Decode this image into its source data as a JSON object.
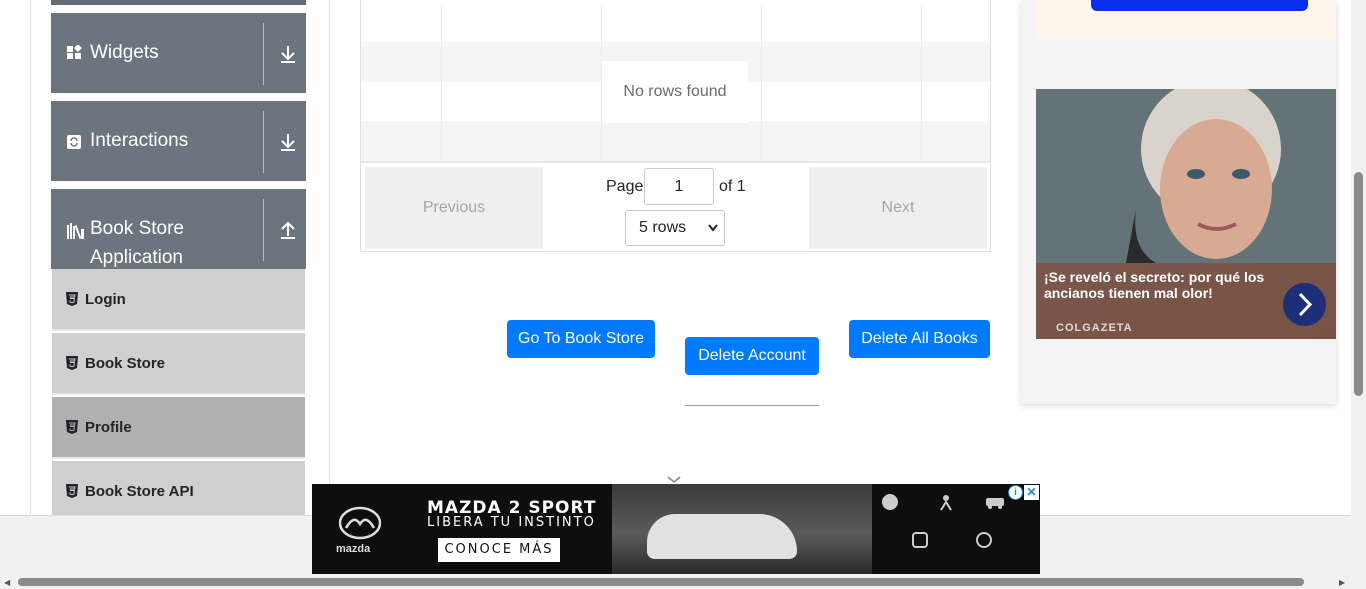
{
  "sidebar": {
    "groups": [
      {
        "label": "Widgets",
        "icon": "widgets-icon",
        "arrow": "download-icon"
      },
      {
        "label": "Interactions",
        "icon": "interactions-icon",
        "arrow": "download-icon"
      },
      {
        "label_line1": "Book Store",
        "label_line2": "Application",
        "icon": "book-store-icon",
        "arrow": "upload-icon"
      }
    ],
    "items": [
      {
        "label": "Login"
      },
      {
        "label": "Book Store"
      },
      {
        "label": "Profile",
        "active": true
      },
      {
        "label": "Book Store API"
      }
    ]
  },
  "table": {
    "empty_text": "No rows found",
    "previous_label": "Previous",
    "next_label": "Next",
    "page_label": "Page",
    "page_value": "1",
    "of_label": "of 1",
    "rows_selected": "5 rows"
  },
  "actions": {
    "go_to_store": "Go To Book Store",
    "delete_account": "Delete Account",
    "delete_all_books": "Delete All Books"
  },
  "right_ad": {
    "headline": "¡Se reveló el secreto: por qué los ancianos tienen mal olor!",
    "source": "COLGAZETA"
  },
  "banner": {
    "title": "MAZDA 2 SPORT",
    "subtitle": "LIBERA TU INSTINTO",
    "cta": "CONOCE MÁS",
    "brand": "mazda",
    "info": "i",
    "close": "✕"
  },
  "colors": {
    "primary": "#007bff",
    "sidebar_group": "#6c757d",
    "menu_item": "#cfcfcf",
    "menu_item_active": "#b0b0b0"
  }
}
